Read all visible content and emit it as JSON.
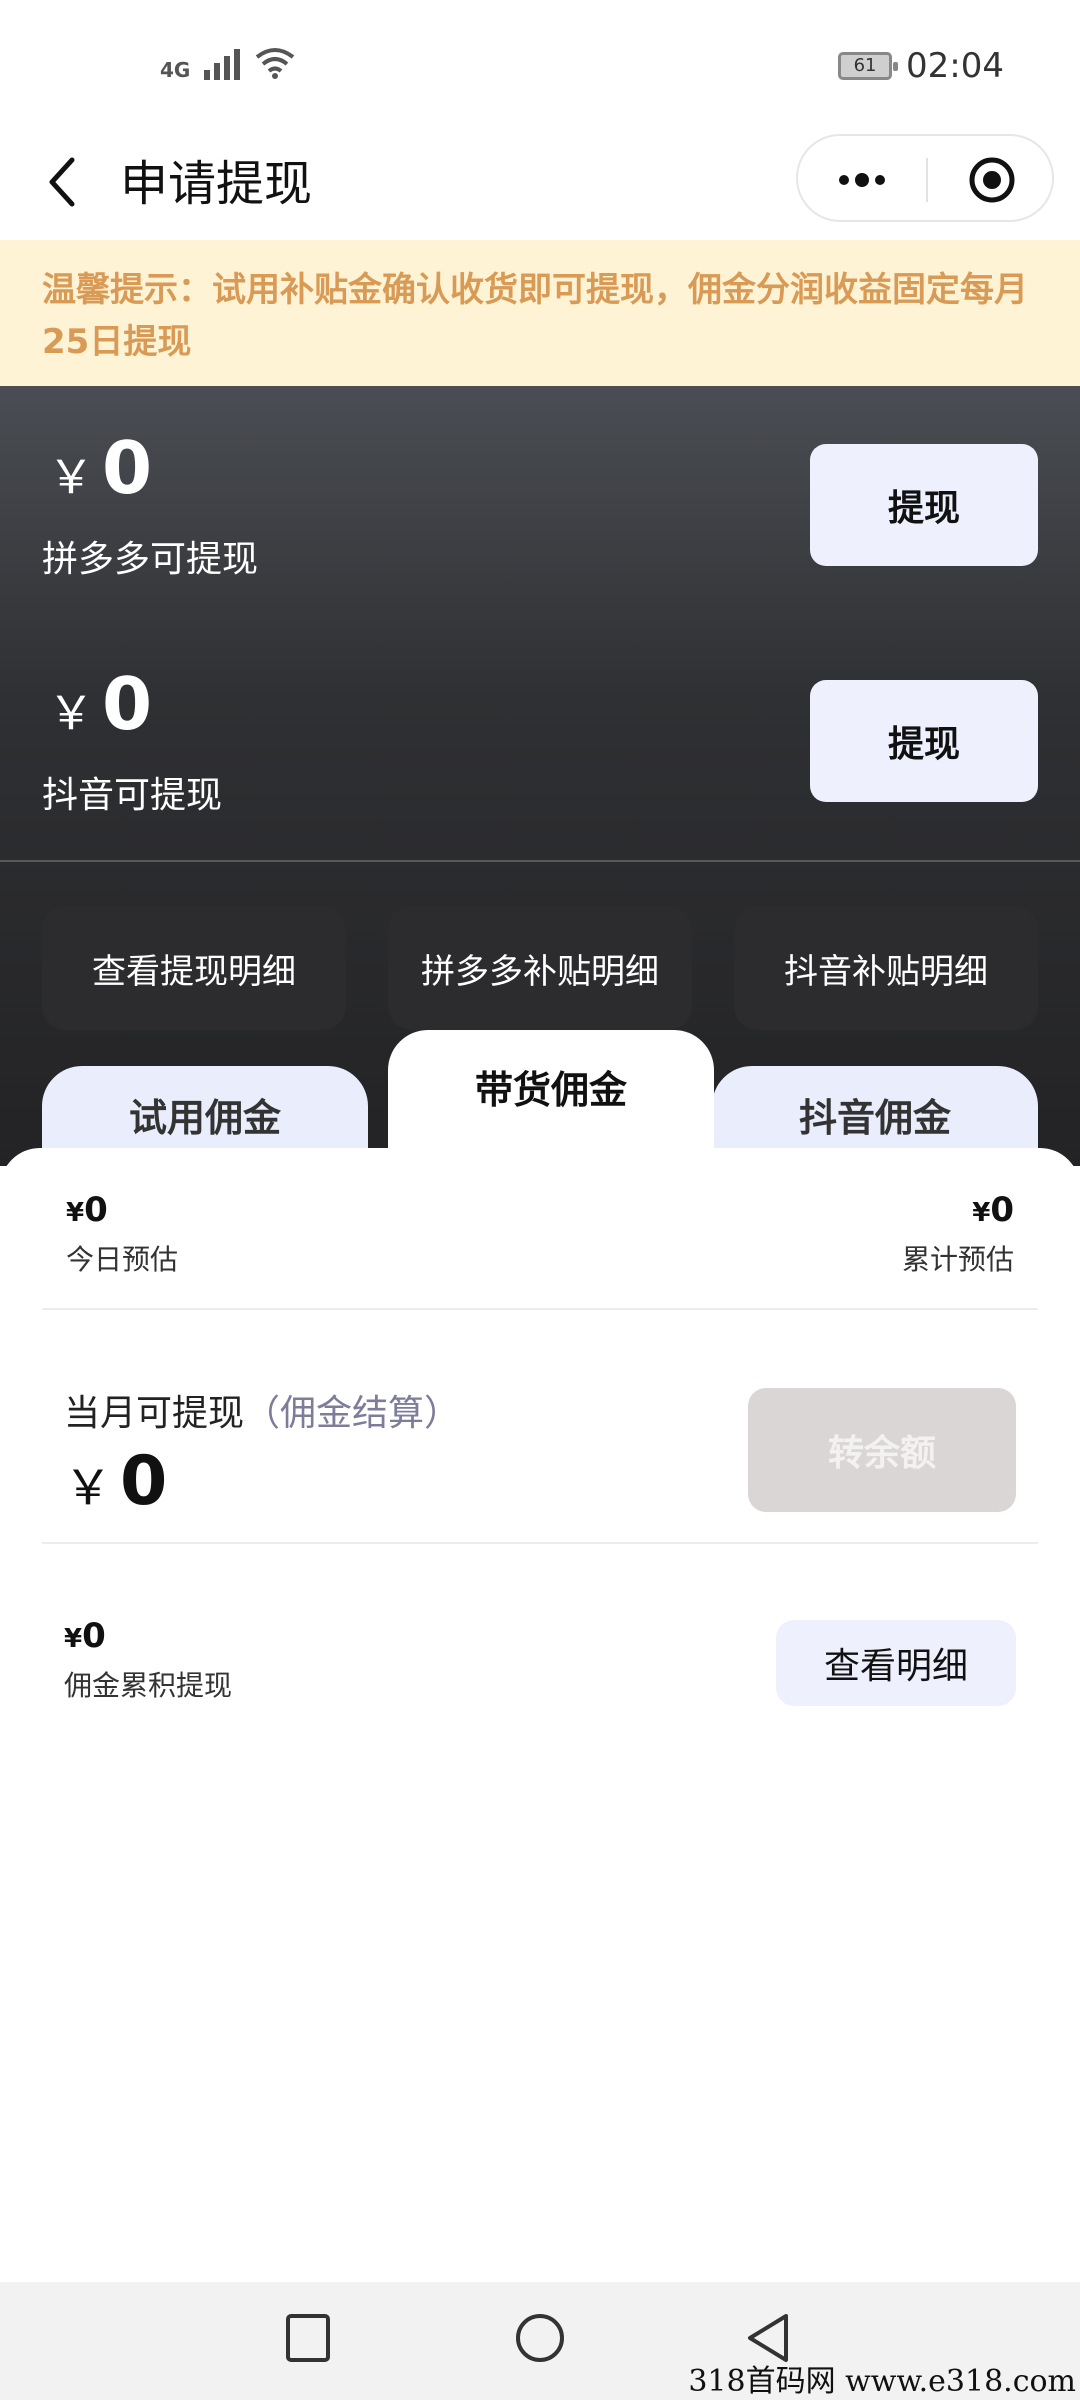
{
  "status_bar": {
    "network": "4G",
    "battery": "61",
    "time": "02:04"
  },
  "nav": {
    "title": "申请提现"
  },
  "notice": {
    "text": "温馨提示：试用补贴金确认收货即可提现，佣金分润收益固定每月25日提现"
  },
  "balances": [
    {
      "currency": "￥",
      "amount": "0",
      "label": "拼多多可提现",
      "button": "提现"
    },
    {
      "currency": "￥",
      "amount": "0",
      "label": "抖音可提现",
      "button": "提现"
    }
  ],
  "detail_buttons": [
    "查看提现明细",
    "拼多多补贴明细",
    "抖音补贴明细"
  ],
  "tabs": [
    {
      "label": "试用佣金",
      "active": false
    },
    {
      "label": "带货佣金",
      "active": true
    },
    {
      "label": "抖音佣金",
      "active": false
    }
  ],
  "estimates": {
    "today": {
      "currency": "¥",
      "amount": "0",
      "label": "今日预估"
    },
    "total": {
      "currency": "¥",
      "amount": "0",
      "label": "累计预估"
    }
  },
  "month": {
    "label": "当月可提现",
    "sub": "（佣金结算）",
    "currency": "￥",
    "amount": "0",
    "button": "转余额"
  },
  "cumulative": {
    "currency": "¥",
    "amount": "0",
    "label": "佣金累积提现",
    "button": "查看明细"
  },
  "watermark": "318首码网  www.e318.com",
  "colors": {
    "notice_bg": "#fff3d5",
    "notice_text": "#d89a55",
    "tab_bg": "#eaedfb",
    "button_bg": "#eef0fd",
    "disabled_bg": "#dad6d6"
  }
}
